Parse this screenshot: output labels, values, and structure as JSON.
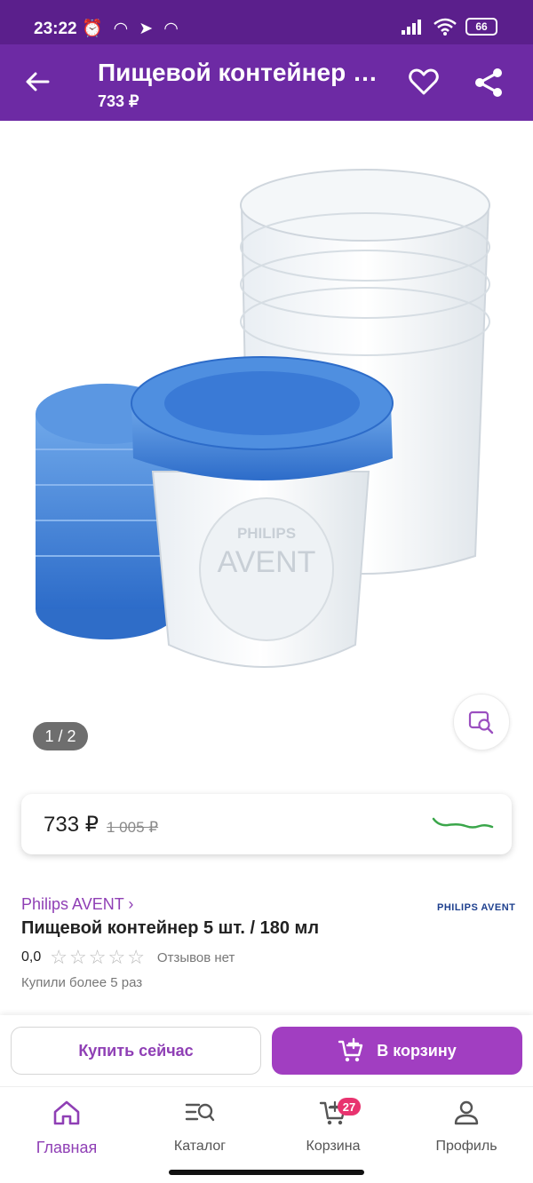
{
  "status_bar": {
    "time": "23:22",
    "battery": "66"
  },
  "app_bar": {
    "title": "Пищевой контейнер 5 шт. / 180 мл",
    "price": "733 ₽"
  },
  "gallery": {
    "counter": "1 / 2"
  },
  "price_card": {
    "current": "733 ₽",
    "old": "1 005 ₽"
  },
  "product": {
    "brand": "Philips AVENT ›",
    "brand_logo": "PHILIPS AVENT",
    "name": "Пищевой контейнер 5 шт. / 180 мл",
    "rating": "0,0",
    "reviews": "Отзывов нет",
    "bought": "Купили более 5 раз"
  },
  "actions": {
    "buy_now": "Купить сейчас",
    "add_to_cart": "В корзину"
  },
  "tabbar": {
    "tabs": [
      {
        "label": "Главная",
        "icon": "home-icon"
      },
      {
        "label": "Каталог",
        "icon": "catalog-search-icon"
      },
      {
        "label": "Корзина",
        "icon": "cart-icon",
        "badge": "27"
      },
      {
        "label": "Профиль",
        "icon": "profile-icon"
      }
    ]
  },
  "colors": {
    "header": "#6d2aa4",
    "statusbar": "#5b1f8c",
    "accent": "#a13ec1",
    "badge": "#e8336f",
    "lid": "#3c7fd8"
  }
}
